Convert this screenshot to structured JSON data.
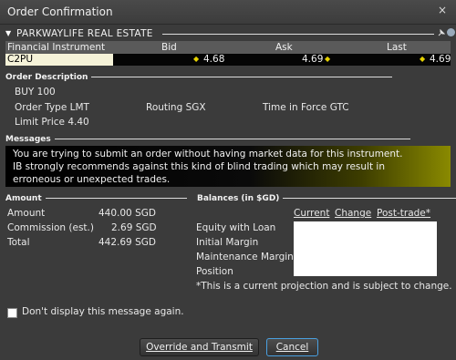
{
  "window": {
    "title": "Order Confirmation",
    "close_glyph": "×"
  },
  "instrument": {
    "name": "PARKWAYLIFE REAL ESTATE",
    "columns": [
      "Financial Instrument",
      "Bid",
      "Ask",
      "Last"
    ],
    "symbol": "C2PU",
    "bid": "4.68",
    "ask": "4.69",
    "last": "4.69"
  },
  "order_description": {
    "header": "Order Description",
    "action": "BUY 100",
    "order_type": "Order Type LMT",
    "routing": "Routing SGX",
    "tif": "Time in Force GTC",
    "limit_price": "Limit Price  4.40"
  },
  "messages": {
    "header": "Messages",
    "line1": "You are trying to submit an order without having market data for this instrument.",
    "line2": "IB strongly recommends against this kind of blind trading which may result in",
    "line3": "erroneous or unexpected trades."
  },
  "amount": {
    "header": "Amount",
    "rows": [
      {
        "label": "Amount",
        "value": "440.00 SGD"
      },
      {
        "label": "Commission (est.)",
        "value": "2.69 SGD"
      },
      {
        "label": "Total",
        "value": "442.69 SGD"
      }
    ]
  },
  "balances": {
    "header": "Balances (in $GD)",
    "tabs": [
      "Current",
      "Change",
      "Post-trade*"
    ],
    "rows": [
      "Equity with Loan",
      "Initial Margin",
      "Maintenance Margin",
      "Position"
    ],
    "note": "*This is a current projection and is subject to change."
  },
  "footer": {
    "checkbox_label": "Don't display this message again.",
    "override_button": "Override and Transmit",
    "cancel_button": "Cancel"
  },
  "colors": {
    "accent_blue": "#3d5bff",
    "symbol_bg": "#f5f2d8",
    "warning_yellow": "#8a8a00",
    "focus_border": "#4aa0e0"
  },
  "icons": [
    "close-icon",
    "collapse-triangle-icon",
    "pin-icon",
    "globe-icon",
    "tick-dot-icon"
  ]
}
